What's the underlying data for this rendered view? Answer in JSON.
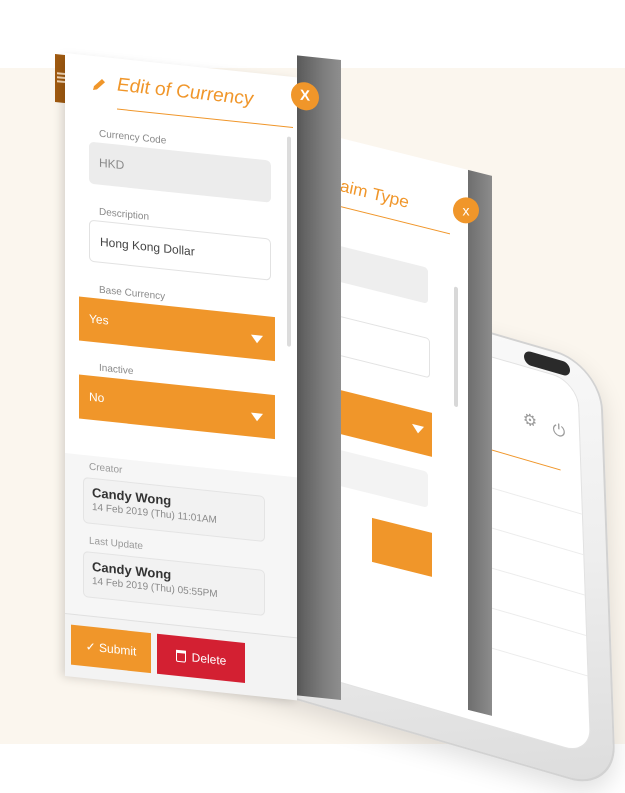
{
  "dialog": {
    "title": "Edit of Currency",
    "close_label": "X",
    "fields": {
      "currency_code": {
        "label": "Currency Code",
        "value": "HKD"
      },
      "description": {
        "label": "Description",
        "value": "Hong Kong Dollar"
      },
      "base_currency": {
        "label": "Base Currency",
        "value": "Yes"
      },
      "inactive": {
        "label": "Inactive",
        "value": "No"
      }
    },
    "creator": {
      "label": "Creator",
      "name": "Candy Wong",
      "date": "14 Feb 2019 (Thu) 11:01AM"
    },
    "last_update": {
      "label": "Last Update",
      "name": "Candy Wong",
      "date": "14 Feb 2019 (Thu) 05:55PM"
    },
    "actions": {
      "submit": "✓ Submit",
      "delete": "Delete"
    }
  },
  "back_dialog": {
    "title": "Claim Type",
    "close_label": "x"
  },
  "colors": {
    "accent": "#f0962a",
    "danger": "#d32032",
    "background": "#fbf6ee"
  },
  "icons": [
    "pencil-icon",
    "close-icon",
    "dropdown-arrow-icon",
    "trash-icon",
    "gear-icon",
    "power-icon",
    "menu-icon"
  ]
}
